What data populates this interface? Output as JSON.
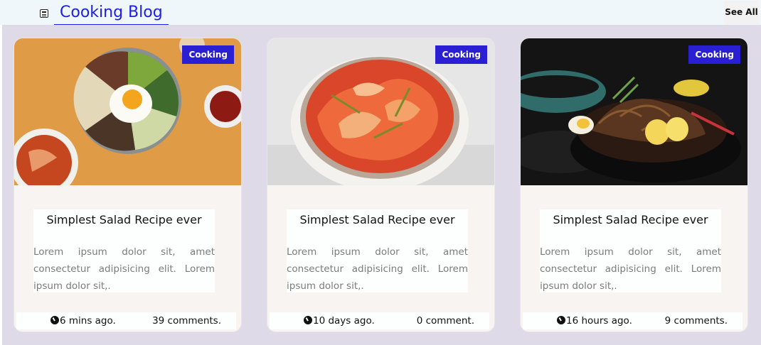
{
  "header": {
    "icon": "newspaper-icon",
    "title": "Cooking Blog",
    "see_all_label": "See All"
  },
  "cards": [
    {
      "image": "bibimbap-bowl-photo",
      "category": "Cooking",
      "title": "Simplest Salad Recipe ever",
      "text": "Lorem ipsum dolor sit, amet consectetur adipisicing elit. Lorem ipsum dolor sit,.",
      "time": "6 mins ago.",
      "comments": "39 comments."
    },
    {
      "image": "kimchi-bowl-photo",
      "category": "Cooking",
      "title": "Simplest Salad Recipe ever",
      "text": "Lorem ipsum dolor sit, amet consectetur adipisicing elit. Lorem ipsum dolor sit,.",
      "time": "10 days ago.",
      "comments": "0 comment."
    },
    {
      "image": "black-bean-noodles-photo",
      "category": "Cooking",
      "title": "Simplest Salad Recipe ever",
      "text": "Lorem ipsum dolor sit, amet consectetur adipisicing elit. Lorem ipsum dolor sit,.",
      "time": "16 hours ago.",
      "comments": "9 comments."
    }
  ],
  "colors": {
    "accent": "#1d1ee6",
    "badge": "#2b1fd3",
    "page_background": "#dedae7",
    "card_background": "#f8f4f1"
  }
}
